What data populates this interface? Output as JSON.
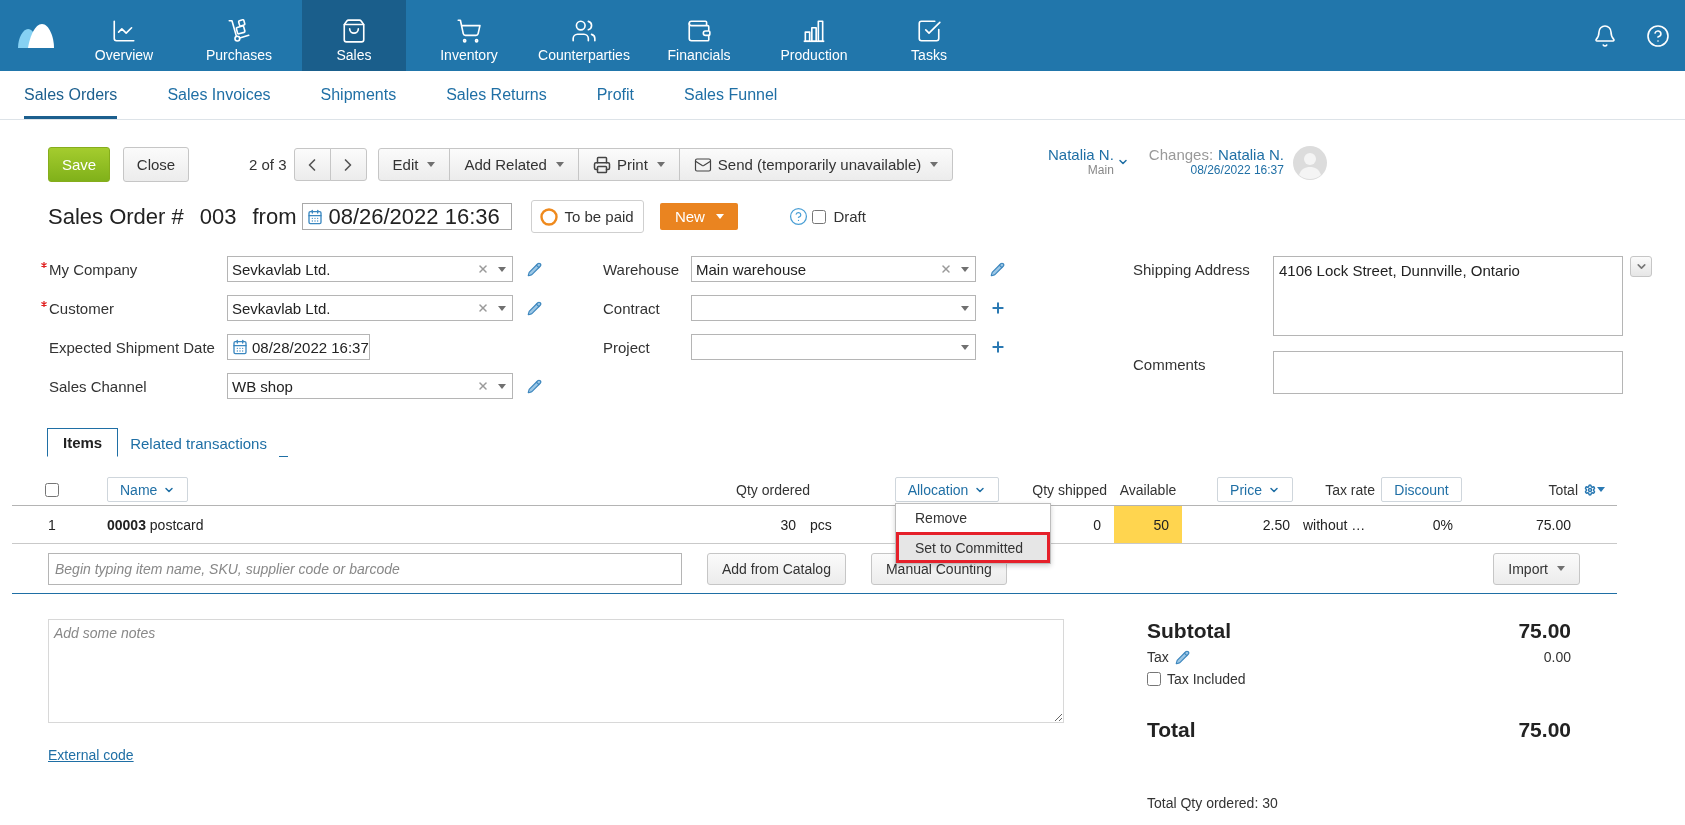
{
  "app_nav": {
    "items": [
      {
        "label": "Overview",
        "selected": false
      },
      {
        "label": "Purchases",
        "selected": false
      },
      {
        "label": "Sales",
        "selected": true
      },
      {
        "label": "Inventory",
        "selected": false
      },
      {
        "label": "Counterparties",
        "selected": false
      },
      {
        "label": "Financials",
        "selected": false
      },
      {
        "label": "Production",
        "selected": false
      },
      {
        "label": "Tasks",
        "selected": false
      }
    ]
  },
  "sub_nav": {
    "tabs": [
      {
        "label": "Sales Orders",
        "selected": true
      },
      {
        "label": "Sales Invoices",
        "selected": false
      },
      {
        "label": "Shipments",
        "selected": false
      },
      {
        "label": "Sales Returns",
        "selected": false
      },
      {
        "label": "Profit",
        "selected": false
      },
      {
        "label": "Sales Funnel",
        "selected": false
      }
    ]
  },
  "toolbar": {
    "save": "Save",
    "close": "Close",
    "pager": "2 of 3",
    "actions": [
      {
        "label": "Edit",
        "kind": "menu"
      },
      {
        "label": "Add Related",
        "kind": "menu"
      },
      {
        "label": "Print",
        "kind": "print"
      },
      {
        "label": "Send (temporarily unavailable)",
        "kind": "mail"
      }
    ]
  },
  "owner": {
    "name": "Natalia N.",
    "group": "Main"
  },
  "changes": {
    "label": "Changes:",
    "user": "Natalia N.",
    "time": "08/26/2022 16:37"
  },
  "header": {
    "title": "Sales Order #",
    "number": "003",
    "from": "from",
    "date": "08/26/2022 16:36",
    "payment_status": "To be paid",
    "status": "New",
    "draft": {
      "label": "Draft",
      "checked": false
    }
  },
  "form": {
    "left": [
      {
        "label": "My Company",
        "required": true,
        "kind": "select",
        "value": "Sevkavlab Ltd."
      },
      {
        "label": "Customer",
        "required": true,
        "kind": "select",
        "value": "Sevkavlab Ltd."
      },
      {
        "label": "Expected Shipment Date",
        "required": false,
        "kind": "date",
        "value": "08/28/2022 16:37"
      },
      {
        "label": "Sales Channel",
        "required": false,
        "kind": "select",
        "value": "WB shop"
      }
    ],
    "middle": [
      {
        "label": "Warehouse",
        "kind": "select",
        "value": "Main warehouse"
      },
      {
        "label": "Contract",
        "kind": "create"
      },
      {
        "label": "Project",
        "kind": "create"
      }
    ],
    "right": [
      {
        "label": "Shipping Address",
        "kind": "address",
        "value": "4106 Lock Street, Dunnville, Ontario"
      },
      {
        "label": "Comments",
        "kind": "textarea"
      }
    ]
  },
  "item_tabs": [
    {
      "label": "Items",
      "selected": true
    },
    {
      "label": "Related transactions",
      "selected": false
    }
  ],
  "table": {
    "select_all": {
      "checked": false
    },
    "columns": [
      {
        "label": "Name",
        "kind": "sort"
      },
      {
        "label": "Qty ordered",
        "kind": "plain"
      },
      {
        "label": "Allocation",
        "kind": "sort"
      },
      {
        "label": "Qty shipped",
        "kind": "plain"
      },
      {
        "label": "Available",
        "kind": "plain"
      },
      {
        "label": "Price",
        "kind": "sort"
      },
      {
        "label": "Tax rate",
        "kind": "plain"
      },
      {
        "label": "Discount",
        "kind": "button"
      },
      {
        "label": "Total",
        "kind": "settings"
      }
    ],
    "rows": [
      {
        "number": "1",
        "name": "**00003** postcard",
        "qty": "30",
        "unit": "pcs",
        "qty_shipped": "0",
        "available": "50",
        "available_warning": true,
        "price": "2.50",
        "tax_rate": "without …",
        "discount": "0%",
        "total": "75.00"
      }
    ]
  },
  "allocation_menu": {
    "items": [
      {
        "label": "Remove",
        "highlighted": false
      },
      {
        "label": "Set to Committed",
        "highlighted": true
      }
    ]
  },
  "add_item": {
    "placeholder": "Begin typing item name, SKU, supplier code or barcode",
    "catalog": "Add from Catalog",
    "counting": "Manual Counting",
    "import": "Import"
  },
  "notes": {
    "placeholder": "Add some notes"
  },
  "external_code": "External code",
  "totals": {
    "subtotal_label": "Subtotal",
    "subtotal": "75.00",
    "tax_label": "Tax",
    "tax": "0.00",
    "tax_included": {
      "label": "Tax Included",
      "checked": false
    },
    "total_label": "Total",
    "total": "75.00",
    "qty_summary": "Total Qty ordered: 30"
  }
}
